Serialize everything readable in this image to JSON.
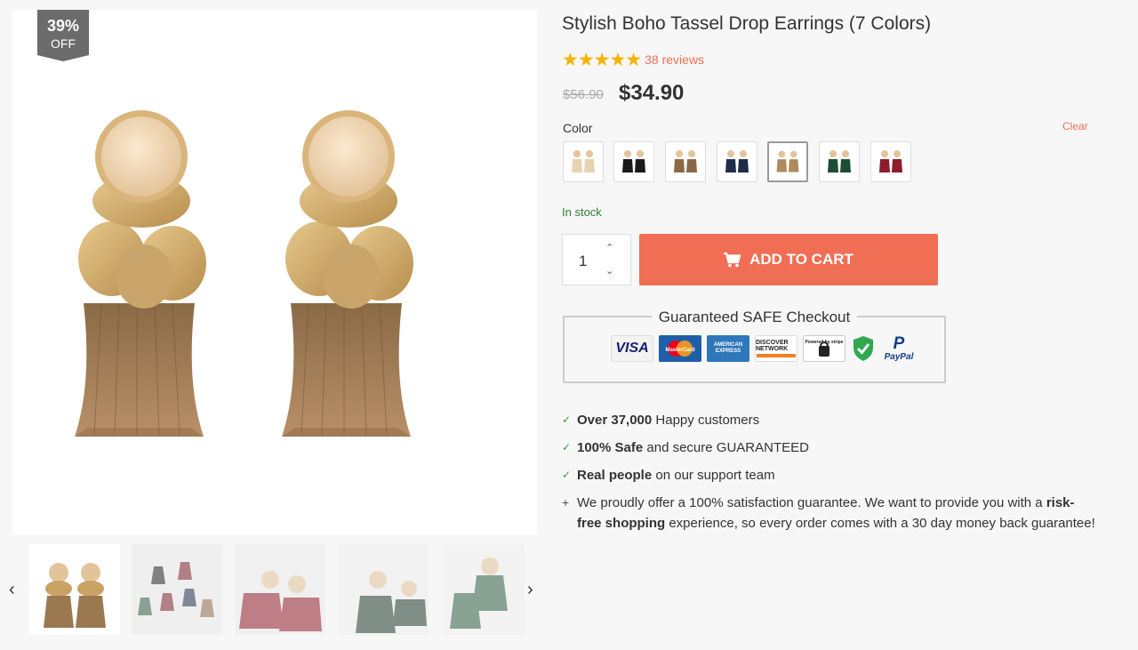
{
  "product": {
    "discount": {
      "percent": "39%",
      "label": "OFF"
    },
    "title": "Stylish Boho Tassel Drop Earrings (7 Colors)",
    "rating": {
      "stars": 5,
      "reviews_label": "38 reviews"
    },
    "old_price": "$56.90",
    "price": "$34.90",
    "color_label": "Color",
    "clear_label": "Clear",
    "swatches": [
      "beige",
      "black",
      "khaki",
      "navy",
      "brown",
      "green",
      "red"
    ],
    "selected_swatch": "brown",
    "stock": "In stock",
    "quantity": "1",
    "add_to_cart": "ADD TO CART",
    "safe_checkout": "Guaranteed SAFE Checkout",
    "payment_icons": [
      "VISA",
      "MasterCard",
      "AMERICAN EXPRESS",
      "DISCOVER NETWORK",
      "Powered by stripe",
      "SSL",
      "PayPal"
    ]
  },
  "bullets": {
    "b1_bold": "Over 37,000",
    "b1_rest": " Happy customers",
    "b2_bold": "100% Safe",
    "b2_rest": " and secure GUARANTEED",
    "b3_bold": "Real people",
    "b3_rest": " on our support team",
    "b4_pre": "We proudly offer a 100% satisfaction guarantee. We want to provide you with a ",
    "b4_bold": "risk-free shopping",
    "b4_post": " experience, so every order comes with a 30 day money back guarantee!"
  },
  "colors": {
    "accent": "#f06e53",
    "star": "#f5b301",
    "stock": "#2e7d32",
    "badge": "#6b6b6b"
  }
}
